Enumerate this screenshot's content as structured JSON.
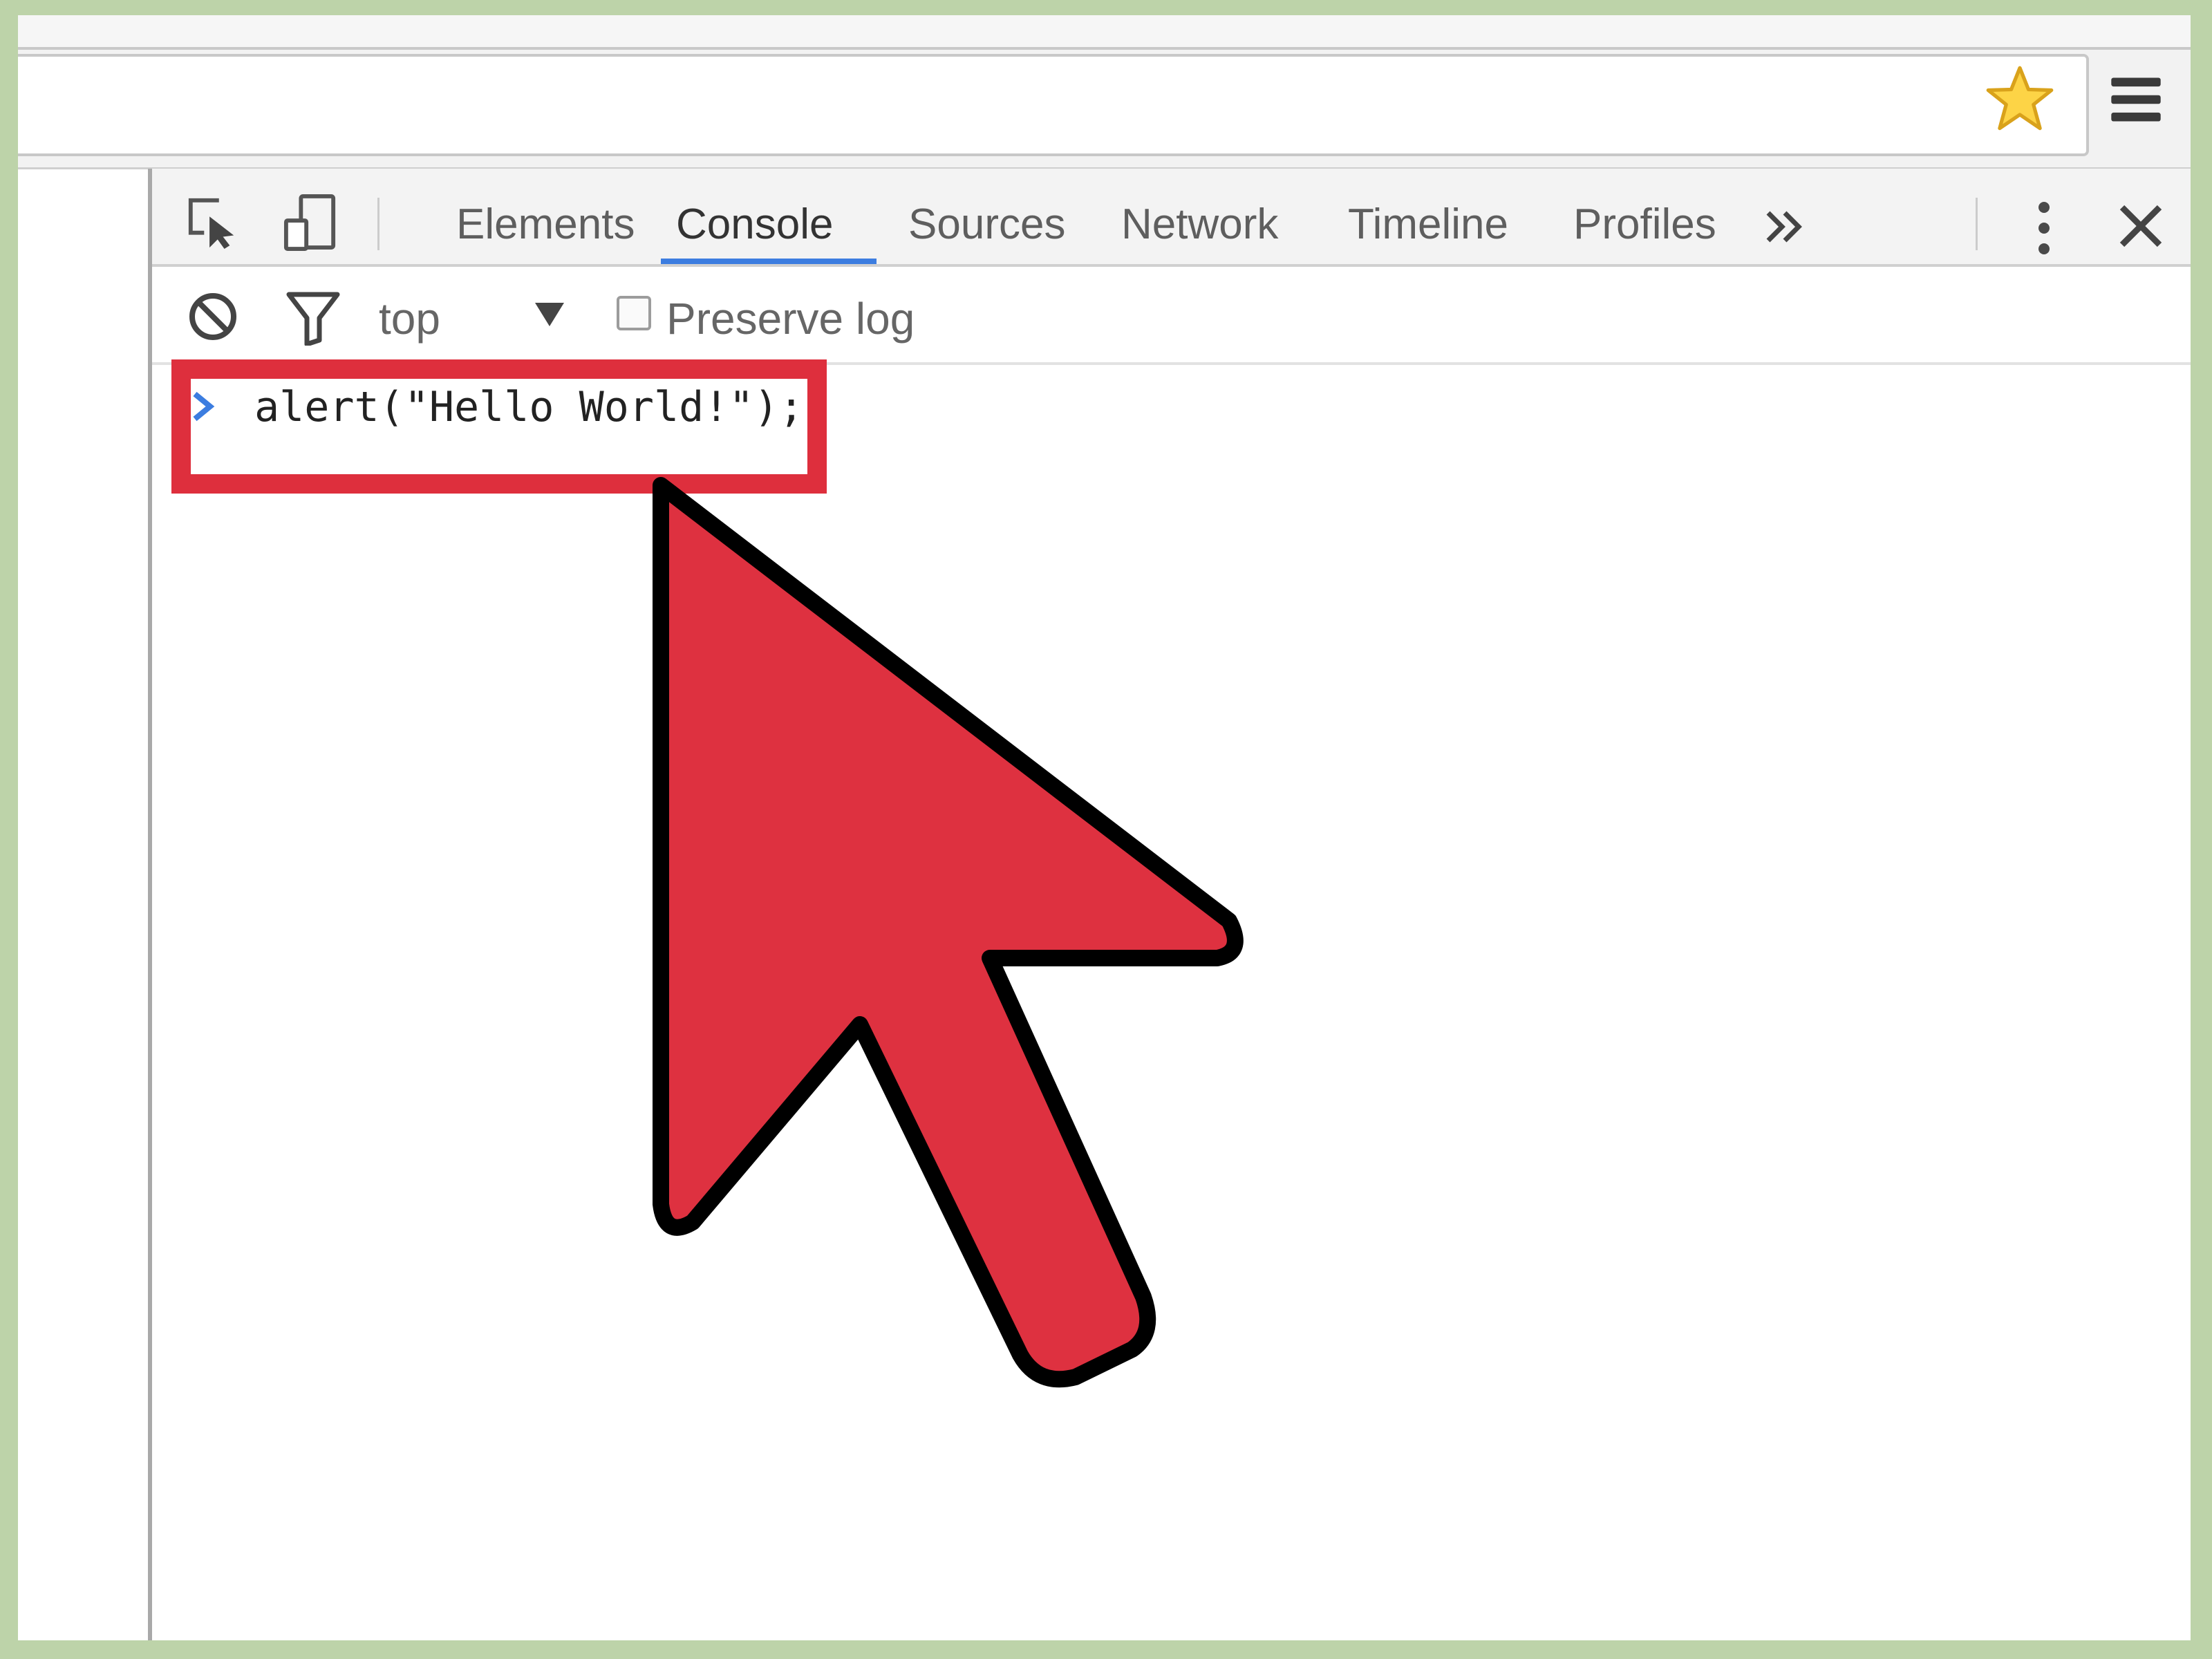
{
  "browser": {
    "bookmark_icon": "star-icon",
    "menu_icon": "hamburger-menu-icon"
  },
  "devtools": {
    "toolbar_icons": [
      "inspect-element-icon",
      "device-mode-icon"
    ],
    "tabs": [
      {
        "label": "Elements",
        "active": false
      },
      {
        "label": "Console",
        "active": true
      },
      {
        "label": "Sources",
        "active": false
      },
      {
        "label": "Network",
        "active": false
      },
      {
        "label": "Timeline",
        "active": false
      },
      {
        "label": "Profiles",
        "active": false
      }
    ],
    "more_tabs_icon": "double-chevron-right-icon",
    "settings_icon": "kebab-menu-icon",
    "close_icon": "close-icon",
    "accent_color": "#3c7de0"
  },
  "console": {
    "clear_icon": "clear-console-icon",
    "filter_icon": "filter-icon",
    "context": "top",
    "preserve_log_label": "Preserve log",
    "preserve_log_checked": false,
    "prompt_icon": "prompt-chevron-icon",
    "input_text": "alert(\"Hello World!\");"
  },
  "annotation": {
    "highlight_color": "#de2f3d",
    "cursor_icon": "big-red-cursor-arrow-icon"
  }
}
